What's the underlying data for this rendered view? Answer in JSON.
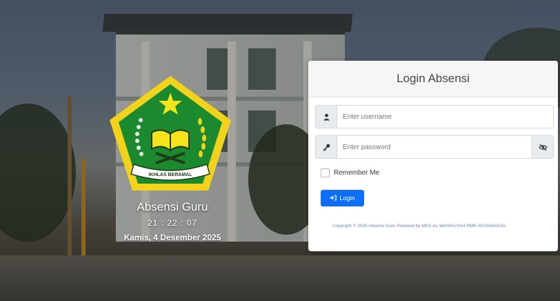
{
  "brand": {
    "title": "Absensi Guru",
    "time": "21 : 22 : 07",
    "date": "Kamis, 4 Desember 2025",
    "logo_ribbon": "IKHLAS BERAMAL",
    "colors": {
      "shield_green": "#1b8a2e",
      "shield_border": "#f2d21b",
      "star": "#f6e31c"
    }
  },
  "login": {
    "title": "Login Absensi",
    "username_placeholder": "Enter username",
    "password_placeholder": "Enter password",
    "remember_label": "Remember Me",
    "button_label": "Login",
    "footer": "Copyright © 2025 Absensi Guru Powered by MAS AL-WASHLIYAH PMR ANTARAGUG",
    "icons": {
      "username": "user-icon",
      "password": "key-icon",
      "toggle": "eye-slash-icon",
      "button": "sign-in-icon"
    }
  },
  "theme": {
    "primary": "#0d6efd",
    "card_header_bg": "#f6f6f6"
  }
}
